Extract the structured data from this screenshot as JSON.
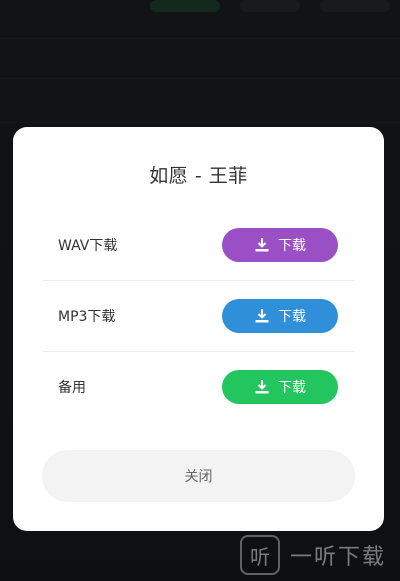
{
  "dialog": {
    "title": "如愿 - 王菲",
    "rows": [
      {
        "label": "WAV下载",
        "button": "下载",
        "color": "#9b4fc4"
      },
      {
        "label": "MP3下载",
        "button": "下载",
        "color": "#2f8fd8"
      },
      {
        "label": "备用",
        "button": "下载",
        "color": "#22c55e"
      }
    ],
    "close_label": "关闭"
  },
  "watermark": {
    "logo_char": "听",
    "text": "一听下载"
  }
}
